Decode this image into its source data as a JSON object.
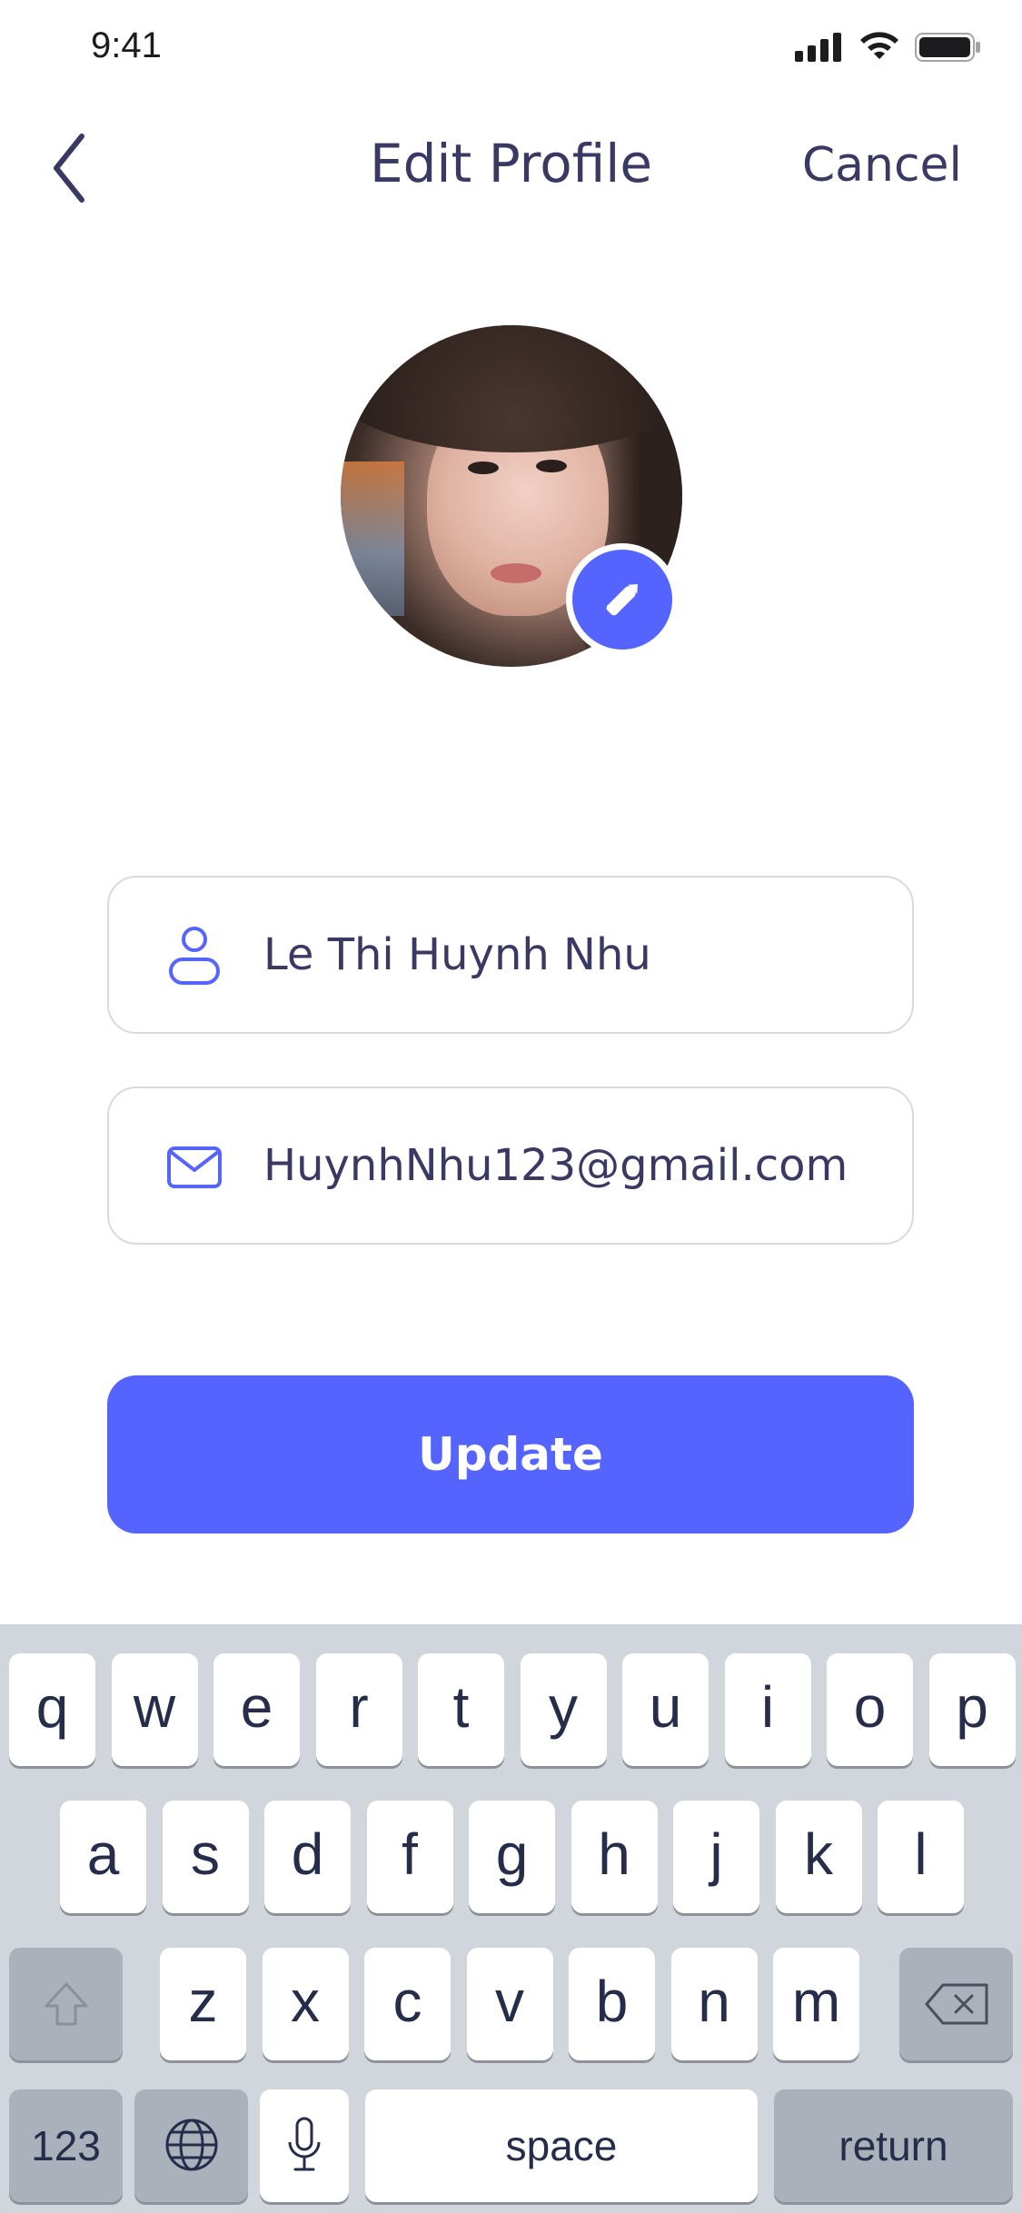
{
  "status_bar": {
    "time": "9:41"
  },
  "header": {
    "title": "Edit Profile",
    "cancel_label": "Cancel"
  },
  "profile": {
    "name": "Le Thi Huynh Nhu",
    "email": "HuynhNhu123@gmail.com"
  },
  "actions": {
    "update_label": "Update"
  },
  "colors": {
    "accent": "#5664ff",
    "text": "#3a3963",
    "keyboard_bg": "#d1d5dc"
  },
  "icons": {
    "back": "chevron-left-icon",
    "edit": "pencil-icon",
    "user": "user-icon",
    "email": "mail-icon"
  },
  "keyboard": {
    "row1": [
      "q",
      "w",
      "e",
      "r",
      "t",
      "y",
      "u",
      "i",
      "o",
      "p"
    ],
    "row2": [
      "a",
      "s",
      "d",
      "f",
      "g",
      "h",
      "j",
      "k",
      "l"
    ],
    "row3": [
      "z",
      "x",
      "c",
      "v",
      "b",
      "n",
      "m"
    ],
    "numbers_label": "123",
    "space_label": "space",
    "return_label": "return"
  }
}
